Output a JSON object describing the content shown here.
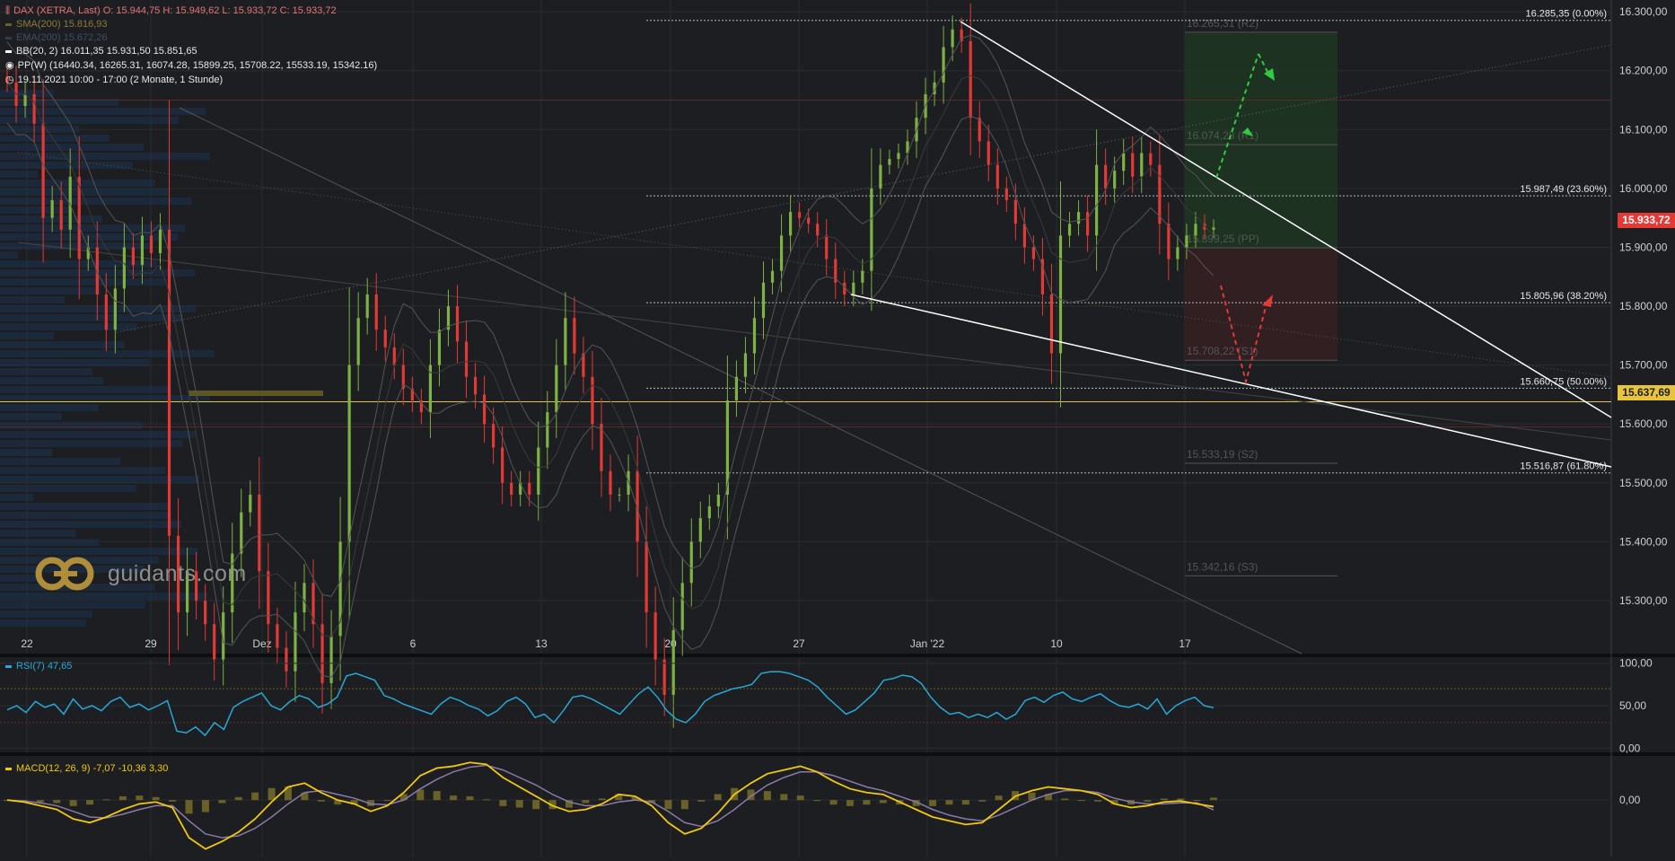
{
  "header": {
    "instrument_line": "DAX (XETRA, Last)  O: 15.944,75  H: 15.949,62  L: 15.933,72  C: 15.933,72",
    "sma_label": "SMA(200)  15.816,93",
    "ema_label": "EMA(200)  15.672,26",
    "bb_label": "BB(20, 2)  16.011,35  15.931,50  15.851,65",
    "pp_label": "PP(W)  (16440.34, 16265.31, 16074.28, 15899.25, 15708.22, 15533.19, 15342.16)",
    "time_label": "19.11.2021 10:00 - 17:00   (2 Monate, 1 Stunde)"
  },
  "logo": {
    "text": "guidants.com"
  },
  "current_price": {
    "label": "15.933,72",
    "value": 15933.72,
    "color": "#e53935"
  },
  "marker_price": {
    "label": "15.637,69",
    "value": 15637.69,
    "color": "#e8c43a"
  },
  "colors": {
    "up": "#7cb342",
    "down": "#e53935",
    "bg": "#1c1e21",
    "grid": "#2a2d31",
    "text": "#cfcfcf",
    "rsi": "#29a8d6",
    "macd": "#f2c80f",
    "signal": "#8a7aa8",
    "hist": "#8a7d2a"
  },
  "chart_data": [
    {
      "type": "line",
      "title": "DAX (XETRA, Last)",
      "timeframe": "1 Stunde",
      "y_ticks": [
        "16.300,00",
        "16.200,00",
        "16.100,00",
        "16.000,00",
        "15.900,00",
        "15.800,00",
        "15.700,00",
        "15.600,00",
        "15.500,00",
        "15.400,00",
        "15.300,00"
      ],
      "ylim": [
        15210,
        16320
      ],
      "x_ticks": [
        "22",
        "29",
        "Dez",
        "6",
        "13",
        "20",
        "27",
        "Jan '22",
        "10",
        "17"
      ],
      "series": [
        {
          "values": [
            16180,
            16140,
            16160,
            16110,
            15950,
            15980,
            15930,
            16020,
            15880,
            15900,
            15820,
            15760,
            15830,
            15900,
            15870,
            15920,
            15890,
            15930,
            15410,
            15280,
            15350,
            15300,
            15260,
            15200,
            15280,
            15380,
            15450,
            15480,
            15350,
            15260,
            15220,
            15180,
            15280,
            15330,
            15260,
            15160,
            15240,
            15400,
            15700,
            15780,
            15820,
            15760,
            15730,
            15700,
            15660,
            15640,
            15620,
            15700,
            15760,
            15800,
            15740,
            15680,
            15650,
            15600,
            15560,
            15500,
            15480,
            15500,
            15480,
            15560,
            15620,
            15700,
            15780,
            15720,
            15680,
            15600,
            15520,
            15480,
            15480,
            15520,
            15400,
            15280,
            15200,
            15140,
            15250,
            15330,
            15400,
            15440,
            15460,
            15480,
            15640,
            15680,
            15720,
            15780,
            15840,
            15860,
            15920,
            15960,
            15950,
            15940,
            15920,
            15880,
            15840,
            15820,
            15840,
            15860,
            16000,
            16040,
            16050,
            16060,
            16080,
            16120,
            16160,
            16180,
            16240,
            16270,
            16250,
            16120,
            16080,
            16040,
            16000,
            15980,
            15940,
            15900,
            15880,
            15820,
            15720,
            15920,
            15940,
            15960,
            15920,
            16040,
            16000,
            16030,
            16060,
            16020,
            16060,
            16040,
            15940,
            15880,
            15900,
            15920,
            15940,
            15930,
            15933.72
          ]
        }
      ],
      "levels": [
        {
          "label": "16.285,35 (0.00%)",
          "value": 16285.35
        },
        {
          "label": "15.987,49 (23.60%)",
          "value": 15987.49
        },
        {
          "label": "15.805,96 (38.20%)",
          "value": 15805.96
        },
        {
          "label": "15.660,75 (50.00%)",
          "value": 15660.75
        },
        {
          "label": "15.516,87 (61.80%)",
          "value": 15516.87
        }
      ],
      "pivots": [
        {
          "label": "16.265,31 (R2)",
          "value": 16265.31
        },
        {
          "label": "16.074,28 (R1)",
          "value": 16074.28
        },
        {
          "label": "15.899,25 (PP)",
          "value": 15899.25
        },
        {
          "label": "15.708,22 (S1)",
          "value": 15708.22
        },
        {
          "label": "15.533,19 (S2)",
          "value": 15533.19
        },
        {
          "label": "15.342,16 (S3)",
          "value": 15342.16
        }
      ]
    },
    {
      "type": "line",
      "title": "RSI(7)",
      "label": "RSI(7)  47,65",
      "y_ticks": [
        "100,00",
        "50,00",
        "0,00"
      ],
      "ylim": [
        -5,
        105
      ],
      "levels": [
        70,
        30
      ],
      "series": [
        {
          "name": "RSI(7)",
          "values": [
            45,
            50,
            42,
            55,
            48,
            52,
            40,
            58,
            46,
            50,
            44,
            55,
            60,
            48,
            52,
            45,
            50,
            56,
            20,
            18,
            25,
            15,
            30,
            22,
            48,
            55,
            60,
            65,
            50,
            45,
            55,
            62,
            58,
            48,
            52,
            60,
            85,
            88,
            84,
            80,
            62,
            58,
            52,
            48,
            44,
            40,
            52,
            60,
            56,
            50,
            46,
            38,
            44,
            55,
            60,
            52,
            36,
            40,
            30,
            44,
            60,
            62,
            58,
            52,
            46,
            40,
            52,
            64,
            72,
            60,
            44,
            34,
            30,
            40,
            55,
            62,
            66,
            70,
            72,
            75,
            88,
            90,
            90,
            88,
            84,
            80,
            72,
            60,
            50,
            40,
            45,
            55,
            65,
            80,
            82,
            86,
            84,
            76,
            60,
            48,
            40,
            42,
            36,
            40,
            36,
            42,
            34,
            40,
            56,
            60,
            54,
            62,
            66,
            58,
            55,
            60,
            64,
            56,
            50,
            48,
            52,
            46,
            58,
            40,
            50,
            56,
            60,
            50,
            47.65
          ]
        }
      ]
    },
    {
      "type": "line",
      "title": "MACD(12, 26, 9)",
      "label": "MACD(12, 26, 9)  -7,07  -10,36  3,30",
      "y_ticks": [
        "0,00"
      ],
      "ylim": [
        -60,
        45
      ],
      "series": [
        {
          "name": "MACD",
          "values": [
            0,
            -2,
            -6,
            -10,
            -20,
            -24,
            -18,
            -10,
            -4,
            -2,
            -8,
            -40,
            -52,
            -44,
            -34,
            -20,
            -2,
            14,
            18,
            8,
            0,
            -4,
            -12,
            -6,
            8,
            26,
            34,
            36,
            40,
            38,
            24,
            14,
            4,
            -6,
            -12,
            -10,
            -4,
            6,
            4,
            -6,
            -24,
            -36,
            -30,
            -14,
            6,
            18,
            28,
            32,
            36,
            30,
            20,
            12,
            8,
            6,
            -2,
            -10,
            -18,
            -22,
            -26,
            -24,
            -10,
            4,
            10,
            14,
            12,
            10,
            6,
            -4,
            -8,
            -6,
            -2,
            -1,
            -4,
            -7.07
          ]
        },
        {
          "name": "Signal",
          "values": [
            0,
            -1,
            -3,
            -6,
            -12,
            -18,
            -19,
            -15,
            -10,
            -6,
            -6,
            -22,
            -36,
            -40,
            -38,
            -30,
            -18,
            -4,
            8,
            10,
            6,
            2,
            -4,
            -5,
            0,
            12,
            22,
            30,
            35,
            37,
            32,
            24,
            16,
            6,
            -2,
            -6,
            -6,
            -2,
            0,
            -2,
            -12,
            -24,
            -28,
            -22,
            -10,
            4,
            16,
            24,
            30,
            30,
            26,
            20,
            14,
            10,
            4,
            -2,
            -10,
            -16,
            -20,
            -22,
            -16,
            -8,
            0,
            6,
            10,
            10,
            8,
            2,
            -2,
            -4,
            -4,
            -3,
            -3,
            -10.36
          ]
        }
      ]
    }
  ]
}
